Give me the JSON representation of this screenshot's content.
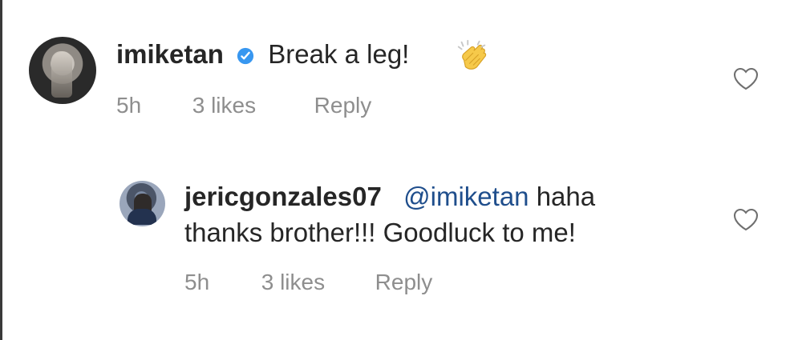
{
  "comments": {
    "top": {
      "username": "imiketan",
      "text": "Break a leg!",
      "time": "5h",
      "likes": "3 likes",
      "reply_label": "Reply",
      "verified_icon": "verified-badge-icon",
      "emoji_icon": "clapping-hands-icon",
      "like_icon": "heart-outline-icon"
    },
    "reply": {
      "username": "jericgonzales07",
      "mention": "@imiketan",
      "text_line1_suffix": " haha",
      "text_line2": "thanks brother!!! Goodluck to me!",
      "time": "5h",
      "likes": "3 likes",
      "reply_label": "Reply",
      "like_icon": "heart-outline-icon"
    }
  },
  "colors": {
    "text": "#262626",
    "muted": "#8e8e8e",
    "mention": "#1f4e8c",
    "verified": "#3897f0",
    "clap": "#f6c94a"
  }
}
